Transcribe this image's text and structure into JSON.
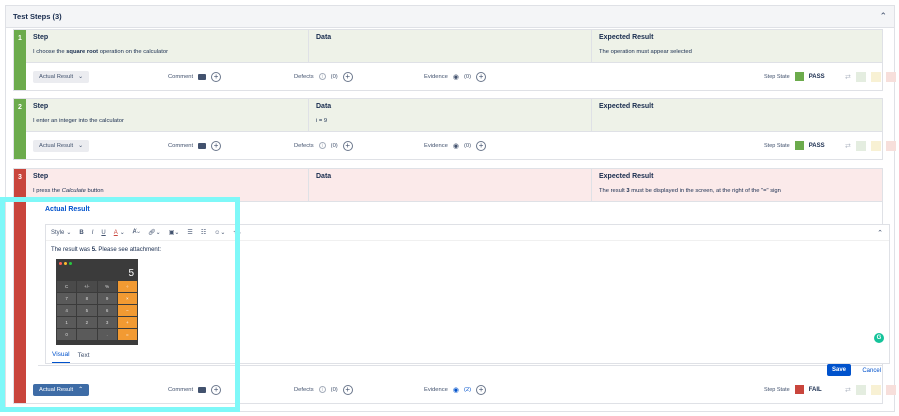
{
  "panel": {
    "title": "Test Steps (3)"
  },
  "headers": {
    "step": "Step",
    "data": "Data",
    "expected": "Expected Result"
  },
  "actions": {
    "actual_result": "Actual Result",
    "comment": "Comment",
    "defects": "Defects",
    "evidence": "Evidence",
    "step_state": "Step State"
  },
  "steps": [
    {
      "number": "1",
      "step_pre": "I choose the ",
      "step_bold": "square root",
      "step_post": " operation on the calculator",
      "data": "",
      "expected": "The operation must appear selected",
      "defects_count": "(0)",
      "evidence_count": "(0)",
      "state": "PASS",
      "state_color": "#6cab4c"
    },
    {
      "number": "2",
      "step_pre": "I enter an integer into the calculator",
      "step_bold": "",
      "step_post": "",
      "data": "i = 9",
      "expected": "",
      "defects_count": "(0)",
      "evidence_count": "(0)",
      "state": "PASS",
      "state_color": "#6cab4c"
    },
    {
      "number": "3",
      "step_pre": "I press the ",
      "step_italic": "Calculate",
      "step_post": " button",
      "data": "",
      "expected_pre": "The result ",
      "expected_bold": "3",
      "expected_post": " must be displayed in the screen, at the right of the \"=\" sign",
      "defects_count": "(0)",
      "evidence_count": "(2)",
      "state": "FAIL",
      "state_color": "#c9453c"
    }
  ],
  "editor": {
    "title": "Actual Result",
    "toolbar": {
      "style": "Style",
      "bold": "B",
      "italic": "I",
      "underline": "U",
      "text_color": "A"
    },
    "text_pre": "The result was ",
    "text_bold": "5.",
    "text_post": " Please see attachment:",
    "tabs": [
      "Visual",
      "Text"
    ],
    "save": "Save",
    "cancel": "Cancel"
  },
  "calculator": {
    "display": "5",
    "keys": [
      "C",
      "+/-",
      "%",
      "÷",
      "7",
      "8",
      "9",
      "×",
      "4",
      "5",
      "6",
      "−",
      "1",
      "2",
      "3",
      "+",
      "0",
      "",
      ".",
      "="
    ]
  }
}
